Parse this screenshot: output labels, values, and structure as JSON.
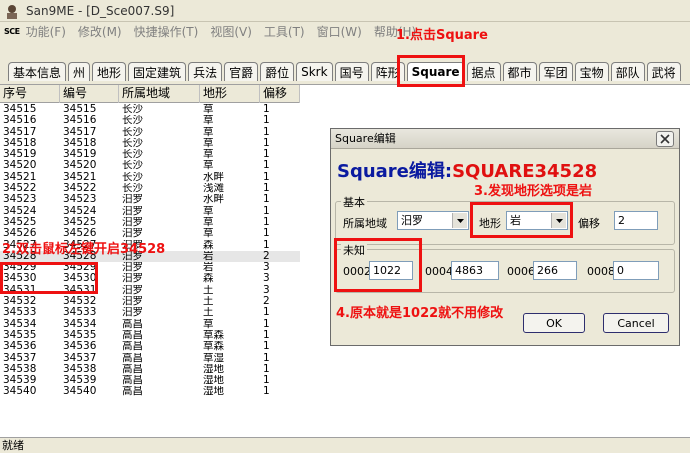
{
  "window": {
    "title": "San9ME - [D_Sce007.S9]"
  },
  "menu": {
    "logo": "SCE",
    "items": [
      "功能(F)",
      "修改(M)",
      "快捷操作(T)",
      "视图(V)",
      "工具(T)",
      "窗口(W)",
      "帮助(H)"
    ]
  },
  "tabs": [
    {
      "label": "基本信息"
    },
    {
      "label": "州"
    },
    {
      "label": "地形"
    },
    {
      "label": "固定建筑"
    },
    {
      "label": "兵法"
    },
    {
      "label": "官爵"
    },
    {
      "label": "爵位"
    },
    {
      "label": "Skrk"
    },
    {
      "label": "国号"
    },
    {
      "label": "阵形"
    },
    {
      "label": "Square"
    },
    {
      "label": "据点"
    },
    {
      "label": "都市"
    },
    {
      "label": "军团"
    },
    {
      "label": "宝物"
    },
    {
      "label": "部队"
    },
    {
      "label": "武将"
    }
  ],
  "table": {
    "columns": [
      "序号",
      "编号",
      "所属地域",
      "地形",
      "偏移"
    ],
    "rows": [
      [
        "34515",
        "34515",
        "长沙",
        "草",
        "1"
      ],
      [
        "34516",
        "34516",
        "长沙",
        "草",
        "1"
      ],
      [
        "34517",
        "34517",
        "长沙",
        "草",
        "1"
      ],
      [
        "34518",
        "34518",
        "长沙",
        "草",
        "1"
      ],
      [
        "34519",
        "34519",
        "长沙",
        "草",
        "1"
      ],
      [
        "34520",
        "34520",
        "长沙",
        "草",
        "1"
      ],
      [
        "34521",
        "34521",
        "长沙",
        "水畔",
        "1"
      ],
      [
        "34522",
        "34522",
        "长沙",
        "浅滩",
        "1"
      ],
      [
        "34523",
        "34523",
        "汨罗",
        "水畔",
        "1"
      ],
      [
        "34524",
        "34524",
        "汨罗",
        "草",
        "1"
      ],
      [
        "34525",
        "34525",
        "汨罗",
        "草",
        "1"
      ],
      [
        "34526",
        "34526",
        "汨罗",
        "草",
        "1"
      ],
      [
        "34527",
        "34527",
        "汨罗",
        "森",
        "1"
      ],
      [
        "34528",
        "34528",
        "汨罗",
        "岩",
        "2"
      ],
      [
        "34529",
        "34529",
        "汨罗",
        "岩",
        "3"
      ],
      [
        "34530",
        "34530",
        "汨罗",
        "森",
        "3"
      ],
      [
        "34531",
        "34531",
        "汨罗",
        "土",
        "3"
      ],
      [
        "34532",
        "34532",
        "汨罗",
        "土",
        "2"
      ],
      [
        "34533",
        "34533",
        "汨罗",
        "土",
        "1"
      ],
      [
        "34534",
        "34534",
        "高昌",
        "草",
        "1"
      ],
      [
        "34535",
        "34535",
        "高昌",
        "草森",
        "1"
      ],
      [
        "34536",
        "34536",
        "高昌",
        "草森",
        "1"
      ],
      [
        "34537",
        "34537",
        "高昌",
        "草湿",
        "1"
      ],
      [
        "34538",
        "34538",
        "高昌",
        "湿地",
        "1"
      ],
      [
        "34539",
        "34539",
        "高昌",
        "湿地",
        "1"
      ],
      [
        "34540",
        "34540",
        "高昌",
        "湿地",
        "1"
      ]
    ],
    "selected_index": 13
  },
  "status": {
    "text": "就绪"
  },
  "dialog": {
    "title": "Square编辑",
    "heading_prefix": "Square编辑:",
    "heading_id": "SQUARE34528",
    "basic": {
      "group_label": "基本",
      "region_label": "所属地域",
      "region_value": "汨罗",
      "terrain_label": "地形",
      "terrain_value": "岩",
      "offset_label": "偏移",
      "offset_value": "2"
    },
    "unknown": {
      "group_label": "未知",
      "fields": [
        {
          "label": "0002",
          "value": "1022"
        },
        {
          "label": "0004",
          "value": "4863"
        },
        {
          "label": "0006",
          "value": "266"
        },
        {
          "label": "0008",
          "value": "0"
        }
      ]
    },
    "ok_label": "OK",
    "cancel_label": "Cancel"
  },
  "annotations": {
    "step1": "1.点击Square",
    "step2": "2.双击鼠标左键开启34528",
    "step3": "3.发现地形选项是岩",
    "step4": "4.原本就是1022就不用修改"
  },
  "colors": {
    "annotation": "#ee1111",
    "heading_blue": "#0a1aa0",
    "heading_red": "#e01010",
    "chrome": "#ece9d8"
  }
}
